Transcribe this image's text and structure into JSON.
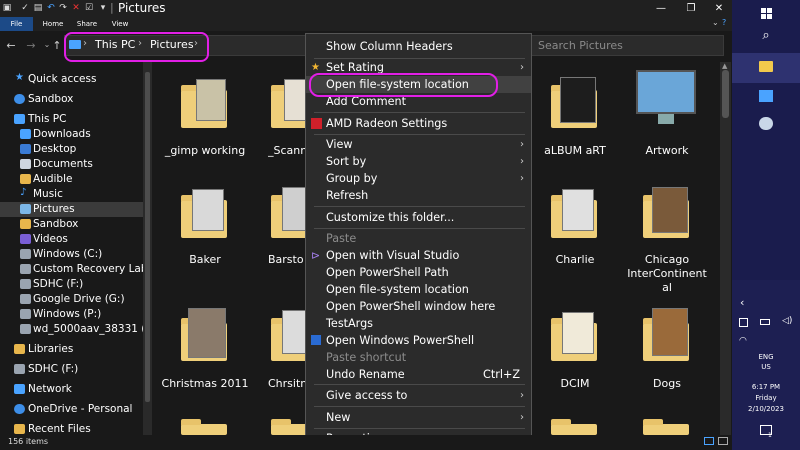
{
  "window": {
    "title": "Pictures"
  },
  "ribbon": {
    "tabs": [
      "File",
      "Home",
      "Share",
      "View"
    ]
  },
  "address": {
    "crumbs": [
      "This PC",
      "Pictures"
    ],
    "search_placeholder": "Search Pictures"
  },
  "nav": {
    "items": [
      "Quick access",
      "Sandbox",
      "This PC",
      "Downloads",
      "Desktop",
      "Documents",
      "Audible",
      "Music",
      "Pictures",
      "Sandbox",
      "Videos",
      "Windows (C:)",
      "Custom Recovery Label",
      "SDHC (F:)",
      "Google Drive (G:)",
      "Windows (P:)",
      "wd_5000aav_38331 (\\\\",
      "Libraries",
      "SDHC (F:)",
      "Network",
      "OneDrive - Personal",
      "Recent Files"
    ]
  },
  "grid": {
    "items": [
      "_gimp working",
      "_Scann Photo",
      "aLBUM aRT",
      "Artwork",
      "Baker",
      "Barsto",
      "Charlie",
      "Chicago InterContinent al",
      "Christmas 2011",
      "Chrsitm Fireplac",
      "DCIM",
      "Dogs"
    ]
  },
  "context_menu": {
    "items": [
      "Show Column Headers",
      "Set Rating",
      "Open file-system location",
      "Add Comment",
      "AMD Radeon Settings",
      "View",
      "Sort by",
      "Group by",
      "Refresh",
      "Customize this folder...",
      "Paste",
      "Open with Visual Studio",
      "Open PowerShell Path",
      "Open file-system location",
      "Open PowerShell window here",
      "TestArgs",
      "Open Windows PowerShell",
      "Paste shortcut",
      "Undo Rename",
      "Give access to",
      "New",
      "Properties"
    ],
    "undo_shortcut": "Ctrl+Z"
  },
  "status": {
    "count": "156 items"
  },
  "taskbar": {
    "lang": "ENG",
    "region": "US",
    "time": "6:17 PM",
    "day": "Friday",
    "date": "2/10/2023",
    "notification_count": "1"
  },
  "colors": {
    "highlight": "#e11fe6",
    "taskbar": "#1a1c4d"
  }
}
